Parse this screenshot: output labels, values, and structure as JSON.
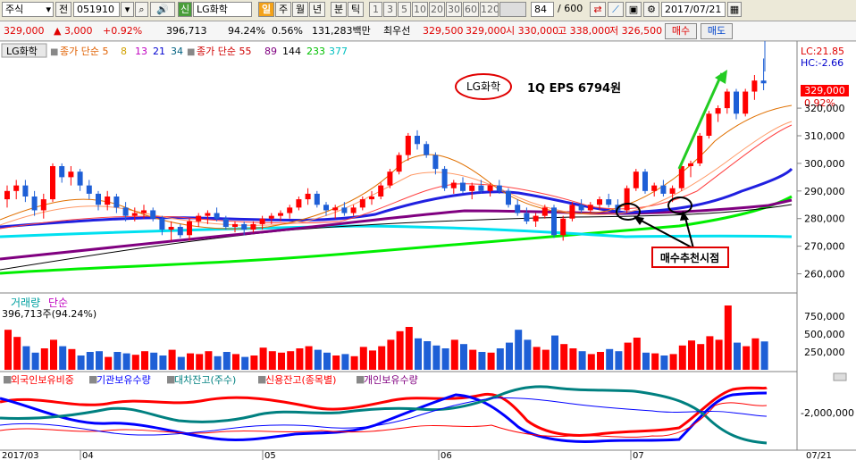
{
  "toolbar": {
    "market": "주식",
    "jeon": "전",
    "code": "051910",
    "badge": "신",
    "name": "LG화학",
    "periods": [
      "일",
      "주",
      "월",
      "년",
      "분",
      "틱"
    ],
    "minutes": [
      "1",
      "3",
      "5",
      "10",
      "20",
      "30",
      "60",
      "120"
    ],
    "count": "84",
    "total": "/ 600",
    "date": "2017/07/21"
  },
  "quote": {
    "price": "329,000",
    "change": "▲ 3,000",
    "change_pct": "+0.92%",
    "volume": "396,713",
    "ratio": "94.24%",
    "turnover_pct": "0.56%",
    "amount": "131,283백만",
    "best_label": "최우선",
    "best_ask": "329,500",
    "best_bid": "329,000",
    "open": "시 330,000",
    "high": "고 338,000",
    "low": "저 326,500",
    "buy_label": "매수",
    "sell_label": "매도"
  },
  "price_panel": {
    "legend_name": "LG화학",
    "legend_ma_short": "종가 단순 5",
    "legend_ma_short_vals": [
      "8",
      "13",
      "21",
      "34"
    ],
    "legend_ma_long": "종가 단순 55",
    "legend_ma_long_vals": [
      "89",
      "144",
      "233",
      "377"
    ],
    "note_name": "LG화학",
    "note_eps": "1Q EPS 6794원",
    "callout": "매수추천시점",
    "lc": "LC:21.85",
    "hc": "HC:-2.66",
    "last_price": "329,000",
    "last_pct": "0.92%",
    "yticks": [
      "320,000",
      "310,000",
      "300,000",
      "290,000",
      "280,000",
      "270,000",
      "260,000"
    ]
  },
  "volume_panel": {
    "title": "거래량",
    "title2": "단순",
    "subtitle": "396,713주(94.24%)",
    "yticks": [
      "750,000",
      "500,000",
      "250,000"
    ]
  },
  "flow_panel": {
    "legend": [
      "외국인보유비중",
      "기관보유수량",
      "대차잔고(주수)",
      "신용잔고(종목별)",
      "개인보유수량"
    ],
    "ytick": "-2,000,000"
  },
  "xaxis": {
    "labels": [
      "2017/03",
      "04",
      "05",
      "06",
      "07",
      "07/21"
    ]
  },
  "chart_data": {
    "type": "candlestick",
    "title": "LG화학",
    "y_unit": "KRW",
    "ylim": [
      255000,
      343000
    ],
    "ohlc": [
      [
        287000,
        292000,
        284000,
        290000
      ],
      [
        290000,
        294000,
        287000,
        292000
      ],
      [
        292000,
        294000,
        286000,
        288000
      ],
      [
        288000,
        290000,
        281000,
        283000
      ],
      [
        283000,
        289000,
        280000,
        287000
      ],
      [
        287000,
        300000,
        286000,
        299000
      ],
      [
        299000,
        300000,
        293000,
        295000
      ],
      [
        295000,
        299000,
        292000,
        297000
      ],
      [
        297000,
        298000,
        290000,
        292000
      ],
      [
        292000,
        294000,
        287000,
        289000
      ],
      [
        289000,
        290000,
        283000,
        285000
      ],
      [
        285000,
        290000,
        283000,
        288000
      ],
      [
        288000,
        289000,
        282000,
        284000
      ],
      [
        284000,
        286000,
        279000,
        281000
      ],
      [
        281000,
        284000,
        279000,
        282000
      ],
      [
        282000,
        285000,
        280000,
        283000
      ],
      [
        283000,
        284000,
        279000,
        280000
      ],
      [
        280000,
        281000,
        274000,
        276000
      ],
      [
        276000,
        279000,
        272000,
        277000
      ],
      [
        277000,
        278000,
        273000,
        274000
      ],
      [
        274000,
        280000,
        272000,
        279000
      ],
      [
        279000,
        282000,
        277000,
        281000
      ],
      [
        281000,
        283000,
        278000,
        282000
      ],
      [
        282000,
        284000,
        279000,
        280000
      ],
      [
        280000,
        281000,
        276000,
        277000
      ],
      [
        277000,
        279000,
        275000,
        278000
      ],
      [
        278000,
        279000,
        274000,
        276000
      ],
      [
        276000,
        279000,
        275000,
        278000
      ],
      [
        278000,
        281000,
        276000,
        280000
      ],
      [
        280000,
        282000,
        278000,
        281000
      ],
      [
        281000,
        283000,
        279000,
        282000
      ],
      [
        282000,
        285000,
        280000,
        284000
      ],
      [
        284000,
        288000,
        283000,
        287000
      ],
      [
        287000,
        291000,
        285000,
        289000
      ],
      [
        289000,
        290000,
        284000,
        285000
      ],
      [
        285000,
        286000,
        281000,
        283000
      ],
      [
        283000,
        285000,
        280000,
        284000
      ],
      [
        284000,
        286000,
        281000,
        282000
      ],
      [
        282000,
        285000,
        281000,
        284000
      ],
      [
        284000,
        288000,
        283000,
        287000
      ],
      [
        287000,
        290000,
        285000,
        288000
      ],
      [
        288000,
        293000,
        287000,
        292000
      ],
      [
        292000,
        298000,
        291000,
        297000
      ],
      [
        297000,
        304000,
        296000,
        303000
      ],
      [
        303000,
        311000,
        301000,
        310000
      ],
      [
        310000,
        312000,
        305000,
        307000
      ],
      [
        307000,
        308000,
        302000,
        303000
      ],
      [
        303000,
        304000,
        296000,
        298000
      ],
      [
        298000,
        299000,
        290000,
        291000
      ],
      [
        291000,
        294000,
        289000,
        293000
      ],
      [
        293000,
        295000,
        289000,
        290000
      ],
      [
        290000,
        293000,
        287000,
        292000
      ],
      [
        292000,
        294000,
        289000,
        290000
      ],
      [
        290000,
        293000,
        288000,
        292000
      ],
      [
        292000,
        294000,
        289000,
        290000
      ],
      [
        290000,
        291000,
        284000,
        285000
      ],
      [
        285000,
        287000,
        281000,
        282000
      ],
      [
        282000,
        284000,
        278000,
        279000
      ],
      [
        279000,
        282000,
        277000,
        281000
      ],
      [
        281000,
        285000,
        280000,
        284000
      ],
      [
        284000,
        285000,
        273000,
        274000
      ],
      [
        274000,
        281000,
        272000,
        280000
      ],
      [
        280000,
        286000,
        279000,
        285000
      ],
      [
        285000,
        287000,
        282000,
        283000
      ],
      [
        283000,
        286000,
        282000,
        285000
      ],
      [
        285000,
        288000,
        283000,
        287000
      ],
      [
        287000,
        289000,
        284000,
        285000
      ],
      [
        285000,
        287000,
        282000,
        283000
      ],
      [
        283000,
        292000,
        282000,
        291000
      ],
      [
        291000,
        298000,
        290000,
        297000
      ],
      [
        297000,
        298000,
        289000,
        290000
      ],
      [
        290000,
        293000,
        288000,
        292000
      ],
      [
        292000,
        294000,
        288000,
        289000
      ],
      [
        289000,
        292000,
        286000,
        291000
      ],
      [
        291000,
        300000,
        290000,
        299000
      ],
      [
        299000,
        301000,
        295000,
        300000
      ],
      [
        300000,
        311000,
        299000,
        310000
      ],
      [
        310000,
        319000,
        309000,
        318000
      ],
      [
        318000,
        321000,
        315000,
        320000
      ],
      [
        320000,
        327000,
        318000,
        326000
      ],
      [
        326000,
        327000,
        316000,
        318000
      ],
      [
        318000,
        327000,
        317000,
        326000
      ],
      [
        326000,
        332000,
        323000,
        330000
      ],
      [
        330000,
        338000,
        326500,
        329000
      ]
    ],
    "volume": [
      560000,
      460000,
      330000,
      240000,
      300000,
      420000,
      330000,
      290000,
      200000,
      250000,
      260000,
      180000,
      250000,
      230000,
      210000,
      260000,
      240000,
      200000,
      280000,
      180000,
      230000,
      220000,
      260000,
      190000,
      250000,
      220000,
      180000,
      200000,
      310000,
      260000,
      240000,
      260000,
      300000,
      330000,
      280000,
      240000,
      200000,
      220000,
      190000,
      320000,
      270000,
      330000,
      420000,
      540000,
      600000,
      440000,
      400000,
      340000,
      300000,
      420000,
      360000,
      280000,
      250000,
      240000,
      300000,
      380000,
      560000,
      420000,
      320000,
      280000,
      480000,
      360000,
      300000,
      260000,
      220000,
      250000,
      290000,
      260000,
      380000,
      450000,
      240000,
      230000,
      200000,
      220000,
      340000,
      410000,
      360000,
      470000,
      420000,
      900000,
      380000,
      330000,
      440000,
      396713
    ],
    "flow_series": [
      {
        "name": "외국인보유비중",
        "color": "#ff0000"
      },
      {
        "name": "기관보유수량",
        "color": "#0000ff"
      },
      {
        "name": "대차잔고(주수)",
        "color": "#008080"
      },
      {
        "name": "신용잔고(종목별)",
        "color": "#ff0000"
      },
      {
        "name": "개인보유수량",
        "color": "#800080"
      }
    ]
  }
}
